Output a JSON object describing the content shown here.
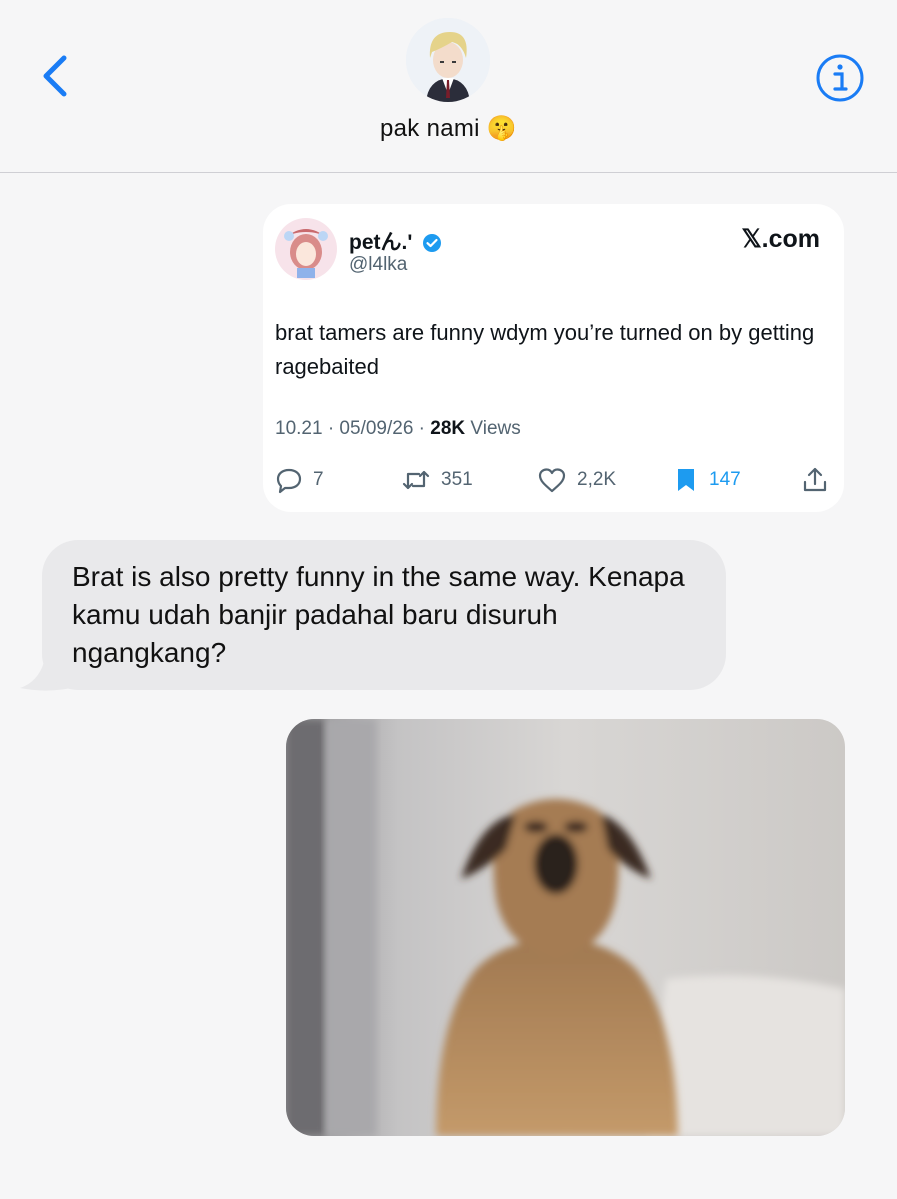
{
  "header": {
    "contact_name": "pak nami",
    "contact_emoji": "🤫",
    "back_icon": "chevron-left-icon",
    "info_icon": "info-circle-icon",
    "accent_color": "#1a7cf5"
  },
  "tweet": {
    "display_name": "petん.'",
    "handle": "@l4lka",
    "source": "𝕏.com",
    "text": "brat tamers are funny wdym you’re turned on by getting ragebaited",
    "time_date": "10.21 · 05/09/26 · ",
    "views_count": "28K",
    "views_label": " Views",
    "replies": "7",
    "reposts": "351",
    "likes": "2,2K",
    "bookmarks": "147",
    "verified_color": "#1d9bf0"
  },
  "messages": {
    "received_text": "Brat is also pretty funny in the same way. Kenapa kamu udah banjir padahal baru disuruh ngangkang?"
  }
}
